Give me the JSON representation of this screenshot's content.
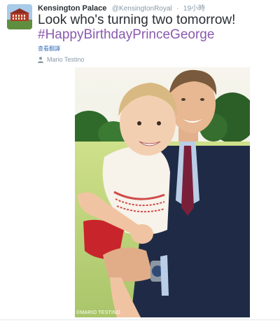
{
  "tweet": {
    "display_name": "Kensington Palace",
    "handle": "@KensingtonRoyal",
    "separator": "·",
    "timestamp": "19小時",
    "text": "Look who's turning two tomorrow!",
    "hashtag": "#HappyBirthdayPrinceGeorge",
    "translate_label": "查看翻譯",
    "photo_credit": "Mario Testino",
    "photo_watermark": "©MARIO TESTINO"
  },
  "icons": {
    "avatar": "kensington-palace-avatar",
    "credit": "person-icon"
  },
  "colors": {
    "hashtag": "#8a5ab0",
    "link": "#3b73b8",
    "secondary_text": "#8899a6"
  }
}
